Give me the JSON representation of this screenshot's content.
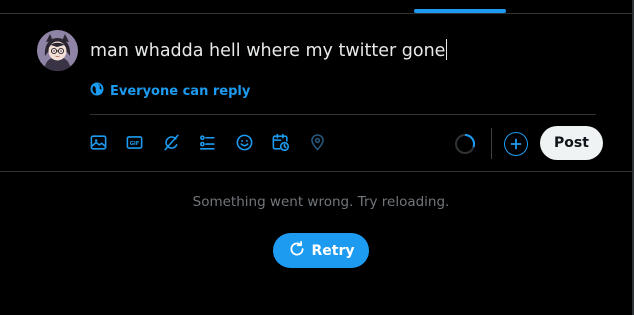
{
  "composer": {
    "text": "man whadda hell where my twitter gone",
    "reply_setting": "Everyone can reply",
    "post_label": "Post"
  },
  "toolbar": {
    "icons": [
      "image-icon",
      "gif-icon",
      "grok-icon",
      "poll-icon",
      "emoji-icon",
      "schedule-icon",
      "location-icon"
    ]
  },
  "feed": {
    "error_message": "Something went wrong. Try reloading.",
    "retry_label": "Retry"
  },
  "colors": {
    "accent": "#1d9bf0",
    "background": "#000000",
    "divider": "#2f3336",
    "muted_text": "#71767b"
  }
}
